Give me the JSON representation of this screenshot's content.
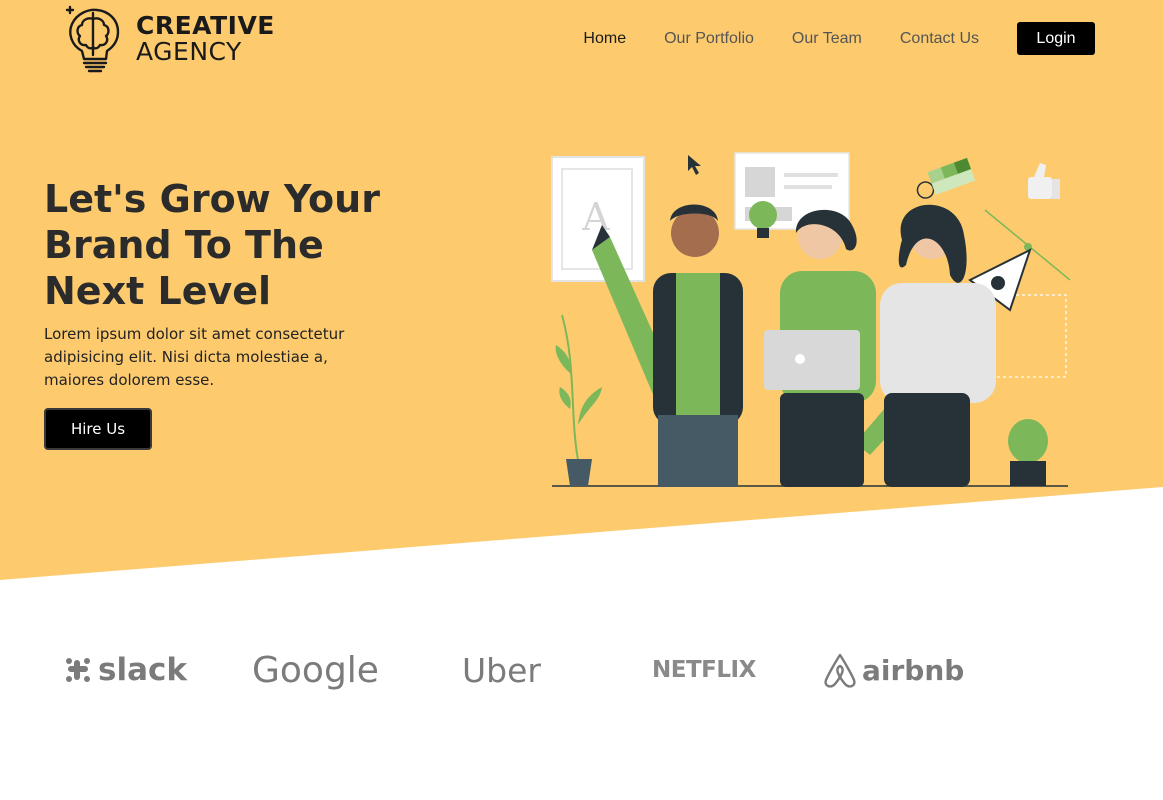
{
  "logo": {
    "line1": "CREATIVE",
    "line2": "AGENCY",
    "icon": "brain-lightbulb-icon"
  },
  "nav": {
    "items": [
      {
        "label": "Home",
        "active": true
      },
      {
        "label": "Our Portfolio",
        "active": false
      },
      {
        "label": "Our Team",
        "active": false
      },
      {
        "label": "Contact Us",
        "active": false
      }
    ],
    "login_label": "Login"
  },
  "hero": {
    "title": "Let's Grow Your Brand To The Next Level",
    "subtitle": "Lorem ipsum dolor sit amet consectetur adipisicing elit. Nisi dicta molestiae a, maiores dolorem esse.",
    "button_label": "Hire Us",
    "illustration": "team-with-design-tools-illustration"
  },
  "brands": [
    {
      "name": "slack",
      "icon": "slack-logo-icon"
    },
    {
      "name": "Google",
      "icon": "google-logo-icon"
    },
    {
      "name": "Uber",
      "icon": "uber-logo-icon"
    },
    {
      "name": "NETFLIX",
      "icon": "netflix-logo-icon"
    },
    {
      "name": "airbnb",
      "icon": "airbnb-logo-icon"
    }
  ],
  "colors": {
    "hero_bg": "#fdcb6e",
    "accent_green": "#7cb85a",
    "dark": "#263238",
    "button": "#000000"
  }
}
